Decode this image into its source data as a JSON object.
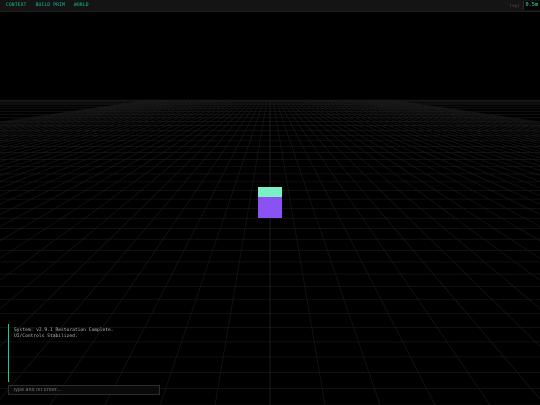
{
  "topbar": {
    "menu": [
      {
        "label": "CONTEXT"
      },
      {
        "label": "BUILD PRIM"
      },
      {
        "label": "WORLD"
      }
    ],
    "status_label": "(sp)",
    "status_value": "0.5m"
  },
  "scene": {
    "grid_color": "#1b1b1b",
    "cube_top_color": "#7bf0c4",
    "cube_front_color": "#8a52f3"
  },
  "console": {
    "lines": [
      "System: v2.9.1 Restoration Complete.",
      "UI/Controls Stabilized."
    ],
    "accent": "#1dc9a3"
  },
  "input": {
    "placeholder": "Type and hit Enter..."
  }
}
